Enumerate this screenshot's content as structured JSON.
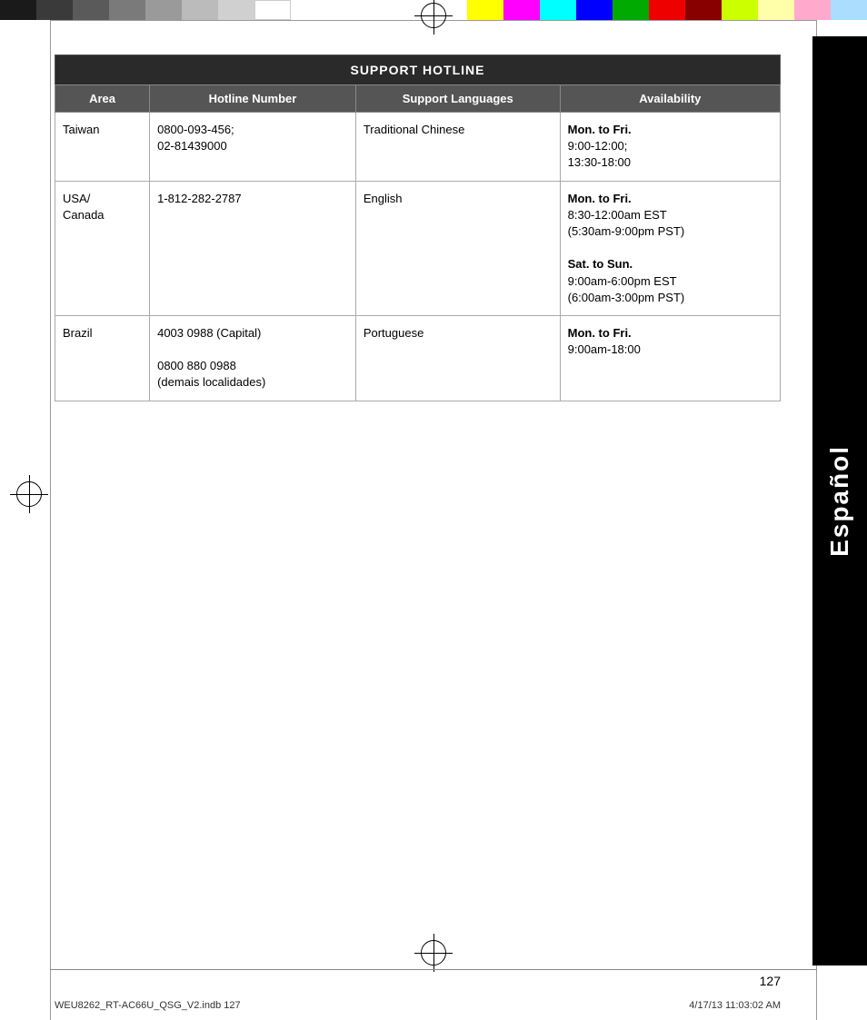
{
  "colorbar": {
    "left_swatches": [
      "#1a1a1a",
      "#3a3a3a",
      "#5a5a5a",
      "#7a7a7a",
      "#9a9a9a",
      "#bbbbbb",
      "#d0d0d0",
      "#ffffff"
    ],
    "right_swatches": [
      "#ffff00",
      "#ff00ff",
      "#00ccff",
      "#0000ff",
      "#009900",
      "#ee0000",
      "#cc0000",
      "#ccdd00",
      "#ffffaa",
      "#ffaacc",
      "#aaddff"
    ]
  },
  "sidebar": {
    "label": "Español"
  },
  "table": {
    "title": "SUPPORT HOTLINE",
    "headers": [
      "Area",
      "Hotline Number",
      "Support Languages",
      "Availability"
    ],
    "rows": [
      {
        "area": "Taiwan",
        "hotline": "0800-093-456;\n02-81439000",
        "languages": "Traditional Chinese",
        "availability_bold": "Mon. to Fri.",
        "availability_regular": "9:00-12:00;\n13:30-18:00",
        "availability_bold2": "",
        "availability_regular2": ""
      },
      {
        "area": "USA/\nCanada",
        "hotline": "1-812-282-2787",
        "languages": "English",
        "availability_bold": "Mon. to Fri.",
        "availability_regular": "8:30-12:00am EST\n(5:30am-9:00pm PST)",
        "availability_bold2": "Sat. to Sun.",
        "availability_regular2": "9:00am-6:00pm EST\n(6:00am-3:00pm PST)"
      },
      {
        "area": "Brazil",
        "hotline": "4003 0988 (Capital)\n\n0800 880 0988\n(demais localidades)",
        "languages": "Portuguese",
        "availability_bold": "Mon. to Fri.",
        "availability_regular": "9:00am-18:00",
        "availability_bold2": "",
        "availability_regular2": ""
      }
    ]
  },
  "page": {
    "number": "127"
  },
  "footer": {
    "left": "WEU8262_RT-AC66U_QSG_V2.indb   127",
    "right": "4/17/13   11:03:02 AM"
  }
}
